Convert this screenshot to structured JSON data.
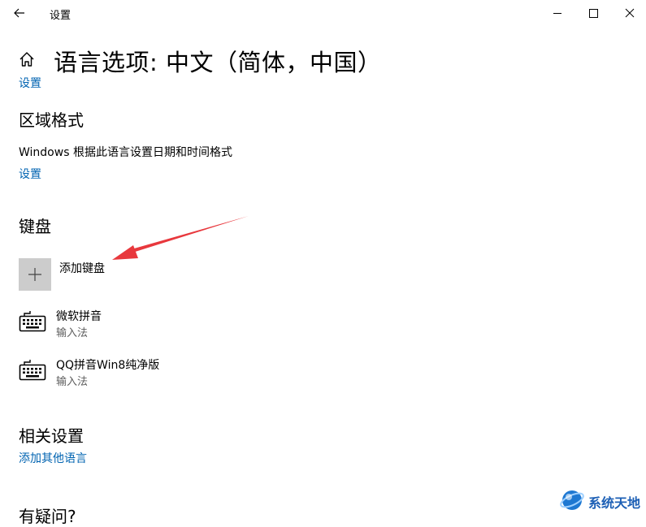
{
  "window": {
    "title": "设置",
    "back_icon": "arrow-left-icon",
    "minimize_icon": "minimize-icon",
    "maximize_icon": "maximize-icon",
    "close_icon": "close-icon"
  },
  "header": {
    "home_icon": "home-icon",
    "title": "语言选项: 中文（简体，中国）"
  },
  "top_link": "设置",
  "region": {
    "heading": "区域格式",
    "description": "Windows 根据此语言设置日期和时间格式",
    "link": "设置"
  },
  "keyboard": {
    "heading": "键盘",
    "add_label": "添加键盘",
    "add_icon": "plus-icon",
    "items": [
      {
        "name": "微软拼音",
        "type": "输入法",
        "icon": "keyboard-icon"
      },
      {
        "name": "QQ拼音Win8纯净版",
        "type": "输入法",
        "icon": "keyboard-icon"
      }
    ]
  },
  "related": {
    "heading": "相关设置",
    "link": "添加其他语言"
  },
  "partial_heading": "有疑问?",
  "watermark": {
    "text": "系统天地",
    "icon": "globe-logo-icon"
  },
  "colors": {
    "link": "#0063b1",
    "tile": "#cccccc",
    "arrow": "#e8383d"
  }
}
